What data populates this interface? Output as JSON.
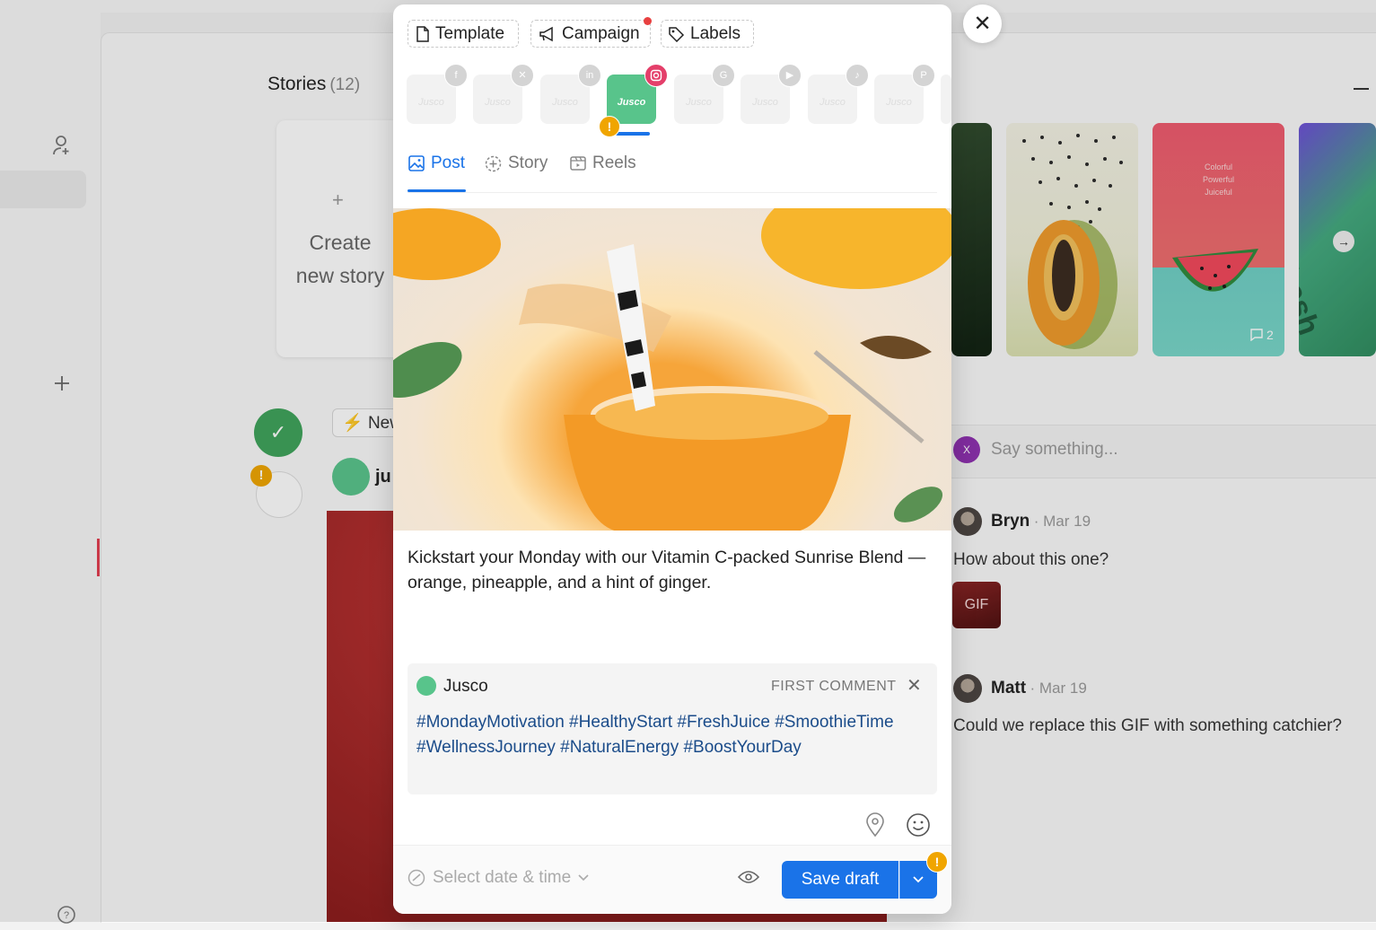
{
  "background": {
    "stories": {
      "title": "Stories",
      "count": "(12)"
    },
    "create_story": {
      "line1": "Create",
      "line2": "new story"
    },
    "new_button": "New",
    "account_short": "ju",
    "comment_placeholder": "Say something...",
    "comment_user_initial": "X",
    "comments": [
      {
        "name": "Bryn",
        "date": "· Mar 19",
        "text": "How about this one?",
        "attachment": "GIF"
      },
      {
        "name": "Matt",
        "date": "· Mar 19",
        "text": "Could we replace this GIF with something catchier?"
      }
    ],
    "story_thumb_text": {
      "colorful": "Colorful",
      "powerful": "Powerful",
      "juiceful": "Juiceful",
      "comment_count": "2",
      "fresh_word": "fresh"
    },
    "colors": {
      "accent_green": "#3ea35a",
      "warning": "#f0a500",
      "sidebar_marker": "#e33d4f"
    }
  },
  "composer": {
    "chips": {
      "template": "Template",
      "campaign": "Campaign",
      "labels": "Labels"
    },
    "accounts": [
      {
        "network": "facebook",
        "logo": "Jusco",
        "active": false
      },
      {
        "network": "x",
        "logo": "Jusco",
        "active": false
      },
      {
        "network": "linkedin",
        "logo": "Jusco",
        "active": false
      },
      {
        "network": "instagram",
        "logo": "Jusco",
        "active": true
      },
      {
        "network": "google",
        "logo": "Jusco",
        "active": false
      },
      {
        "network": "youtube",
        "logo": "Jusco",
        "active": false
      },
      {
        "network": "tiktok",
        "logo": "Jusco",
        "active": false
      },
      {
        "network": "pinterest",
        "logo": "Jusco",
        "active": false
      }
    ],
    "tabs": {
      "post": "Post",
      "story": "Story",
      "reels": "Reels",
      "active": "post"
    },
    "caption": "Kickstart your Monday with our Vitamin C-packed Sunrise Blend — orange, pineapple, and a hint of ginger.",
    "first_comment": {
      "account": "Jusco",
      "label": "FIRST COMMENT",
      "text": "#MondayMotivation #HealthyStart #FreshJuice #SmoothieTime #WellnessJourney #NaturalEnergy #BoostYourDay"
    },
    "footer": {
      "date_placeholder": "Select date & time",
      "save_label": "Save draft"
    },
    "colors": {
      "primary": "#1a73e8",
      "instagram": "#e43f6a",
      "brand_green": "#58c48b"
    }
  }
}
